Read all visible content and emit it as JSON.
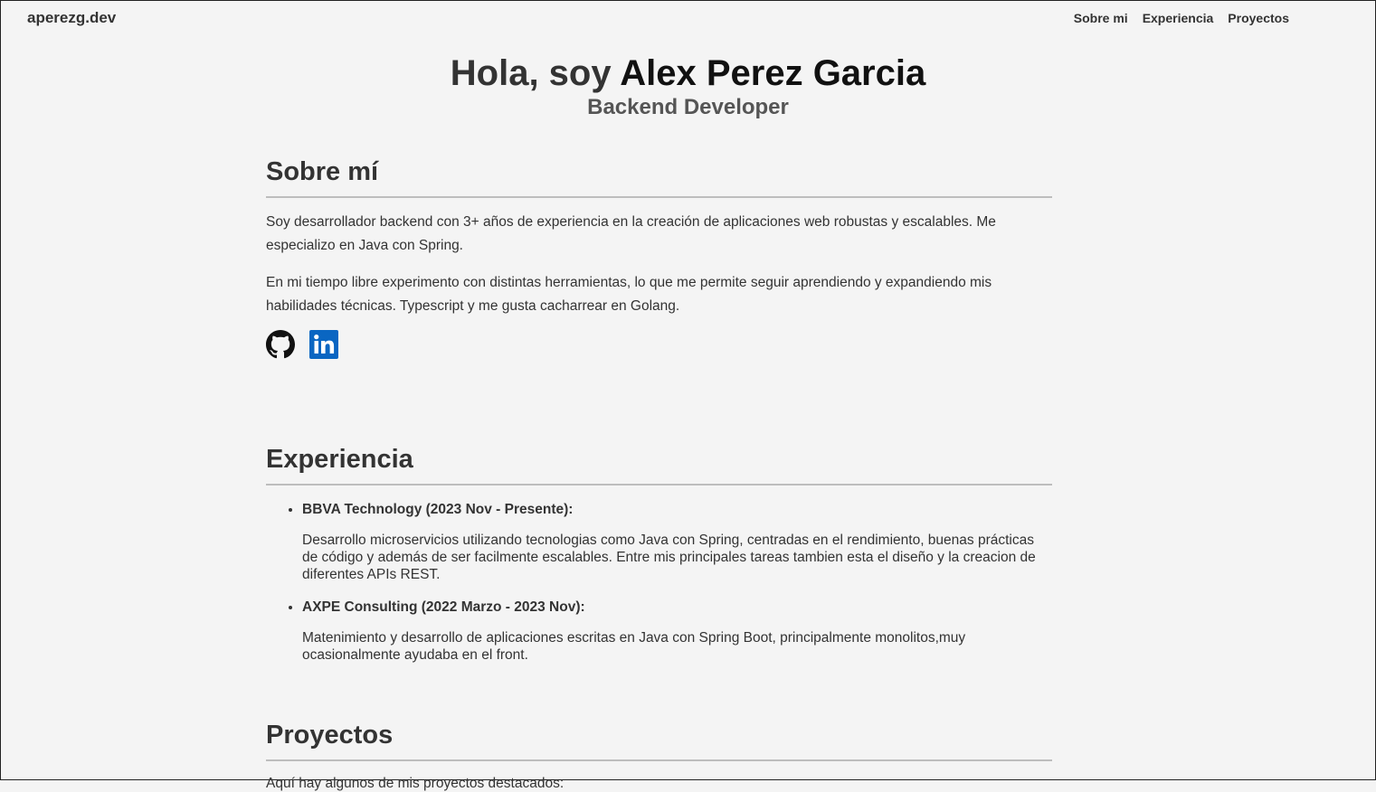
{
  "header": {
    "brand": "aperezg.dev",
    "nav": [
      "Sobre mi",
      "Experiencia",
      "Proyectos"
    ]
  },
  "hero": {
    "greeting": "Hola, soy ",
    "name": "Alex Perez Garcia",
    "role": "Backend Developer"
  },
  "about": {
    "title": "Sobre mí",
    "paragraphs": [
      "Soy desarrollador backend con 3+ años de experiencia en la creación de aplicaciones web robustas y escalables. Me especializo en Java con Spring.",
      "En mi tiempo libre experimento con distintas herramientas, lo que me permite seguir aprendiendo y expandiendo mis habilidades técnicas. Typescript y me gusta cacharrear en Golang."
    ],
    "social": [
      "github-icon",
      "linkedin-icon"
    ]
  },
  "experience": {
    "title": "Experiencia",
    "items": [
      {
        "heading": "BBVA Technology (2023 Nov - Presente):",
        "description": "Desarrollo microservicios utilizando tecnologias como Java con Spring, centradas en el rendimiento, buenas prácticas de código y además de ser facilmente escalables. Entre mis principales tareas tambien esta el diseño y la creacion de diferentes APIs REST."
      },
      {
        "heading": "AXPE Consulting (2022 Marzo - 2023 Nov):",
        "description": "Matenimiento y desarrollo de aplicaciones escritas en Java con Spring Boot, principalmente monolitos,muy ocasionalmente ayudaba en el front."
      }
    ]
  },
  "projects": {
    "title": "Proyectos",
    "intro": "Aquí hay algunos de mis proyectos destacados:"
  },
  "colors": {
    "background": "#f4f4f4",
    "text": "#333333",
    "linkedin": "#0a66c2"
  }
}
